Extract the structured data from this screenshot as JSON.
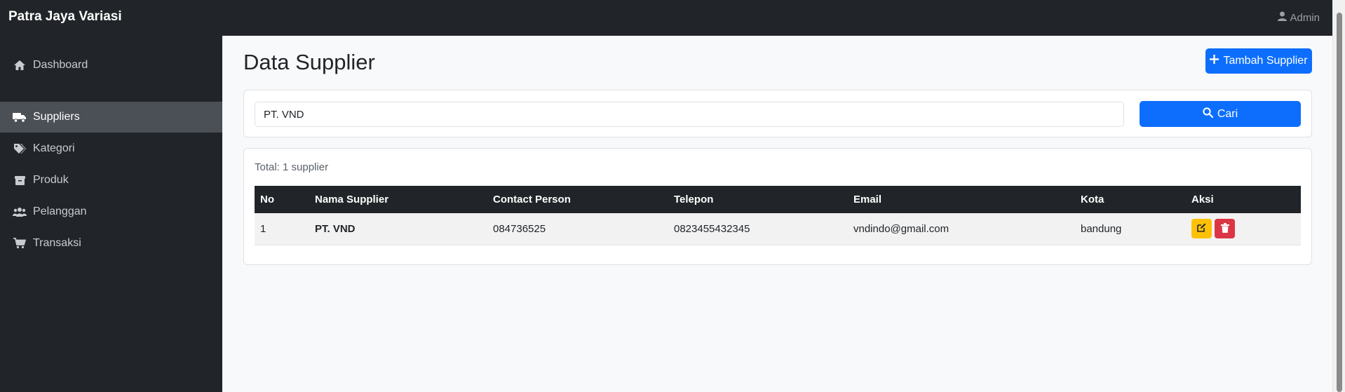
{
  "app": {
    "brand": "Patra Jaya Variasi",
    "user": "Admin"
  },
  "sidebar": {
    "items": [
      {
        "label": "Dashboard",
        "icon": "home-icon"
      },
      {
        "label": "Suppliers",
        "icon": "truck-icon",
        "active": true
      },
      {
        "label": "Kategori",
        "icon": "tags-icon"
      },
      {
        "label": "Produk",
        "icon": "box-icon"
      },
      {
        "label": "Pelanggan",
        "icon": "users-icon"
      },
      {
        "label": "Transaksi",
        "icon": "cart-icon"
      }
    ]
  },
  "page": {
    "title": "Data Supplier",
    "add_label": "Tambah Supplier"
  },
  "search": {
    "value": "PT. VND",
    "button_label": "Cari"
  },
  "table": {
    "total": "Total: 1 supplier",
    "headers": [
      "No",
      "Nama Supplier",
      "Contact Person",
      "Telepon",
      "Email",
      "Kota",
      "Aksi"
    ],
    "rows": [
      [
        "1",
        "PT. VND",
        "084736525",
        "0823455432345",
        "vndindo@gmail.com",
        "bandung"
      ]
    ]
  },
  "colors": {
    "primary": "#0d6efd",
    "warning": "#ffc107",
    "danger": "#dc3545",
    "dark": "#212529"
  }
}
